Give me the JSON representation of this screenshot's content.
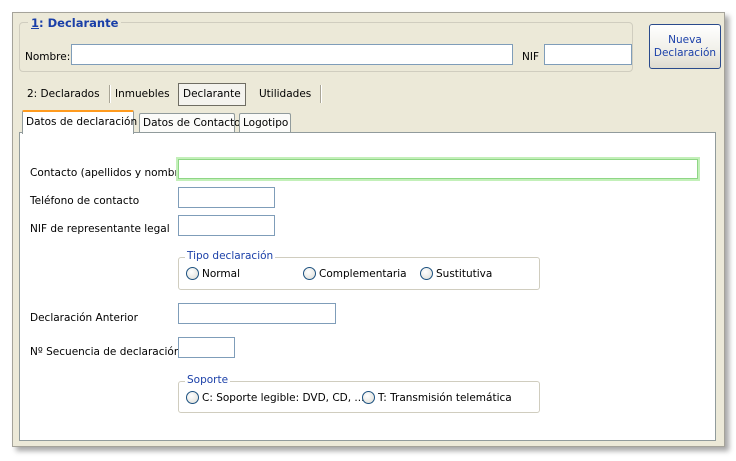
{
  "header": {
    "legend_prefix": "1",
    "legend_text": ": Declarante",
    "nombre_label": "Nombre:",
    "nombre_value": "",
    "nif_label": "NIF",
    "nif_value": ""
  },
  "nueva_button": {
    "line1": "Nueva",
    "line2": "Declaración"
  },
  "top_tabs": [
    {
      "label": "2: Declarados"
    },
    {
      "label": "Inmuebles"
    },
    {
      "label": "Declarante"
    },
    {
      "label": "Utilidades"
    }
  ],
  "sub_tabs": [
    {
      "label": "Datos de declaración"
    },
    {
      "label": "Datos de Contacto"
    },
    {
      "label": "Logotipo"
    }
  ],
  "form": {
    "contacto_label": "Contacto (apellidos y nombre)",
    "contacto_value": "",
    "telefono_label": "Teléfono de contacto",
    "telefono_value": "",
    "nif_rep_label": "NIF de representante legal",
    "nif_rep_value": "",
    "tipo": {
      "legend": "Tipo declaración",
      "options": [
        "Normal",
        "Complementaria",
        "Sustitutiva"
      ]
    },
    "anterior_label": "Declaración Anterior",
    "anterior_value": "",
    "secuencia_label": "Nº Secuencia de declaración",
    "secuencia_value": "",
    "soporte": {
      "legend": "Soporte",
      "options": [
        "C: Soporte legible: DVD, CD, ...",
        "T: Transmisión telemática"
      ]
    }
  }
}
